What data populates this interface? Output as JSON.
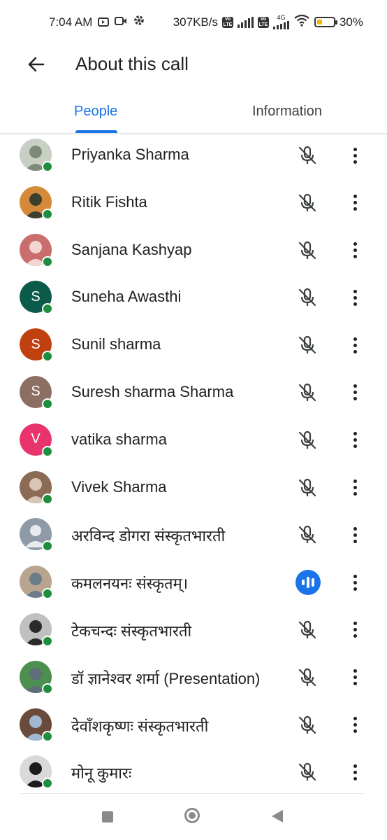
{
  "status_bar": {
    "time": "7:04 AM",
    "net_speed": "307KB/s",
    "volte_label": "Vo LTE",
    "network_type": "4G",
    "battery": "30%",
    "battery_level": 0.3,
    "icons": [
      "youtube-icon",
      "video-icon",
      "gear-icon",
      "volte-icon",
      "signal-icon",
      "wifi-icon",
      "battery-icon"
    ]
  },
  "app_bar": {
    "title": "About this call",
    "back_icon": "arrow-left-icon"
  },
  "tabs": [
    {
      "label": "People",
      "selected": true
    },
    {
      "label": "Information",
      "selected": false
    }
  ],
  "colors": {
    "accent": "#1a73e8",
    "online": "#1e8e3e"
  },
  "participants": [
    {
      "name": "Priyanka Sharma",
      "avatar_type": "photo",
      "mic": "muted"
    },
    {
      "name": "Ritik Fishta",
      "avatar_type": "photo",
      "mic": "muted"
    },
    {
      "name": "Sanjana Kashyap",
      "avatar_type": "photo",
      "mic": "muted"
    },
    {
      "name": "Suneha Awasthi",
      "avatar_type": "letter",
      "initial": "S",
      "avatar_color": "#0b5a4a",
      "mic": "muted"
    },
    {
      "name": "Sunil sharma",
      "avatar_type": "letter",
      "initial": "S",
      "avatar_color": "#c1400f",
      "mic": "muted"
    },
    {
      "name": "Suresh sharma Sharma",
      "avatar_type": "letter",
      "initial": "S",
      "avatar_color": "#8d6e63",
      "mic": "muted"
    },
    {
      "name": "vatika sharma",
      "avatar_type": "letter",
      "initial": "V",
      "avatar_color": "#e8336d",
      "mic": "muted"
    },
    {
      "name": "Vivek Sharma",
      "avatar_type": "photo",
      "mic": "muted"
    },
    {
      "name": "अरविन्द डोगरा संस्कृतभारती",
      "avatar_type": "default",
      "mic": "muted"
    },
    {
      "name": "कमलनयनः संस्कृतम्।",
      "avatar_type": "photo",
      "mic": "speaking"
    },
    {
      "name": "टेकचन्दः संस्कृतभारती",
      "avatar_type": "photo",
      "mic": "muted"
    },
    {
      "name": "डॉ ज्ञानेश्वर शर्मा (Presentation)",
      "avatar_type": "photo",
      "mic": "muted"
    },
    {
      "name": "देवाँशकृष्णः संस्कृतभारती",
      "avatar_type": "photo",
      "mic": "muted"
    },
    {
      "name": "मोनू कुमारः",
      "avatar_type": "photo",
      "mic": "muted"
    }
  ],
  "nav_bar": {
    "icons": [
      "recents-icon",
      "home-icon",
      "back-icon"
    ]
  }
}
